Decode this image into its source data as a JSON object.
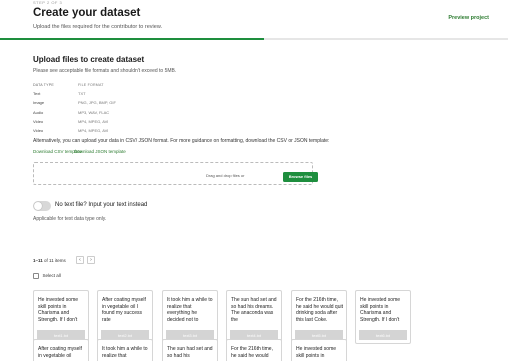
{
  "header": {
    "step": "STEP 2 OF 3",
    "title": "Create your dataset",
    "subtitle": "Upload the files required for the contributor to review.",
    "preview_link": "Preview project",
    "progress": 0.52,
    "progress_color": "#1e8e3e"
  },
  "upload": {
    "title": "Upload files to create dataset",
    "description": "Please see acceptable file formats and shouldn't exceed to 5MB.",
    "table": {
      "headers": [
        "DATA TYPE",
        "FILE FORMAT"
      ],
      "rows": [
        {
          "type": "Text",
          "format": "TXT"
        },
        {
          "type": "Image",
          "format": "PNG, JPG, BMP, GIF"
        },
        {
          "type": "Audio",
          "format": "MP3, WAV, FLAC"
        },
        {
          "type": "Video",
          "format": "MP4, MPEG, AVI"
        },
        {
          "type": "Video",
          "format": "MP4, MPEG, AVI"
        }
      ]
    },
    "alternative_text": "Alternatively, you can upload your data in CSV/ JSON format. For more guidance on formatting, download the CSV or JSON template:",
    "download_csv": "Download CSV template",
    "download_json": "Download JSON template",
    "dropzone_text": "Drag and drop files or",
    "browse_button": "Browse files"
  },
  "text_toggle": {
    "label": "No text file? Input your text instead",
    "help": "Applicable for text data type only.",
    "enabled": false
  },
  "items": {
    "range": "1–11",
    "total_text": "of 11 items",
    "prev_icon": "chevron-left-icon",
    "next_icon": "chevron-right-icon",
    "prev_glyph": "‹",
    "next_glyph": "›",
    "select_all": "Select all",
    "cards_row1": [
      {
        "text": "He invested some skill points in Charisma and Strength. If I don't",
        "file": "text1.txt"
      },
      {
        "text": "After coating myself in vegetable oil I found my success rate",
        "file": "text2.txt"
      },
      {
        "text": "It took him a while to realize that everything he decided not to",
        "file": "text3.txt"
      },
      {
        "text": "The sun had set and so had his dreams. The anaconda was the",
        "file": "text4.txt"
      },
      {
        "text": "For the 216th time, he said he would quit drinking soda after this last Coke.",
        "file": "text5.txt"
      },
      {
        "text": "He invested some skill points in Charisma and Strength. If I don't",
        "file": "text6.txt"
      }
    ],
    "cards_row2": [
      {
        "text": "After coating myself in vegetable oil"
      },
      {
        "text": "It took him a while to realize that"
      },
      {
        "text": "The sun had set and so had his"
      },
      {
        "text": "For the 216th time, he said he would"
      },
      {
        "text": "He invested some skill points in"
      }
    ]
  }
}
